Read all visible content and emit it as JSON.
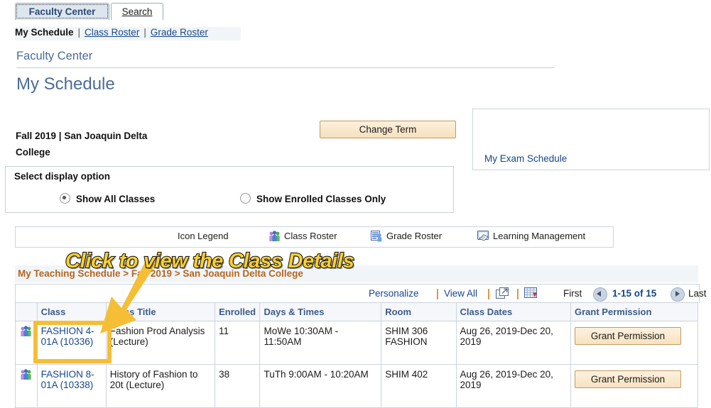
{
  "tabs": [
    {
      "label": "Faculty Center",
      "active": true
    },
    {
      "label": "Search",
      "active": false
    }
  ],
  "subnav": {
    "current": "My Schedule",
    "separator": "|",
    "links": [
      "Class Roster",
      "Grade Roster"
    ]
  },
  "header": {
    "breadcrumb_title": "Faculty Center",
    "page_title": "My Schedule"
  },
  "term": {
    "label": "Fall 2019 | San Joaquin Delta College",
    "change_term_button": "Change Term"
  },
  "exam_panel": {
    "link": "My Exam Schedule"
  },
  "display_option": {
    "title": "Select display option",
    "options": [
      {
        "label": "Show All Classes",
        "selected": true
      },
      {
        "label": "Show Enrolled Classes Only",
        "selected": false
      }
    ]
  },
  "legend": {
    "title": "Icon Legend",
    "items": [
      {
        "label": "Class Roster",
        "icon": "class-roster-icon"
      },
      {
        "label": "Grade Roster",
        "icon": "grade-roster-icon"
      },
      {
        "label": "Learning Management",
        "icon": "learning-management-icon"
      }
    ]
  },
  "schedule": {
    "group_header": "My Teaching Schedule > Fall 2019 > San Joaquin Delta College",
    "toolbar": {
      "personalize": "Personalize",
      "view_all": "View All",
      "popup_icon": "new-window-icon",
      "download_icon": "download-spreadsheet-icon",
      "first": "First",
      "prev_icon": "previous-page-icon",
      "range": "1-15 of 15",
      "next_icon": "next-page-icon",
      "last": "Last"
    },
    "columns": [
      "",
      "Class",
      "Class Title",
      "Enrolled",
      "Days & Times",
      "Room",
      "Class Dates",
      "Grant Permission"
    ],
    "rows": [
      {
        "roster_icon": "class-roster-icon",
        "class": "FASHION 4-01A (10336)",
        "title": "Fashion Prod Analysis (Lecture)",
        "enrolled": "11",
        "days_times": "MoWe 10:30AM - 11:50AM",
        "room": "SHIM 306 FASHION",
        "dates": "Aug 26, 2019-Dec 20, 2019",
        "permission_button": "Grant Permission"
      },
      {
        "roster_icon": "class-roster-icon",
        "class": "FASHION 8-01A (10338)",
        "title": "History of Fashion to 20t (Lecture)",
        "enrolled": "38",
        "days_times": "TuTh 9:00AM - 10:20AM",
        "room": "SHIM 402",
        "dates": "Aug 26, 2019-Dec 20, 2019",
        "permission_button": "Grant Permission"
      }
    ]
  },
  "annotation": {
    "text": "Click to view the Class Details",
    "text_color": "#FFD02E",
    "outline_color": "#1a1a1a",
    "arrow_color": "#F5BE35",
    "highlight_color": "#F5BE35"
  }
}
